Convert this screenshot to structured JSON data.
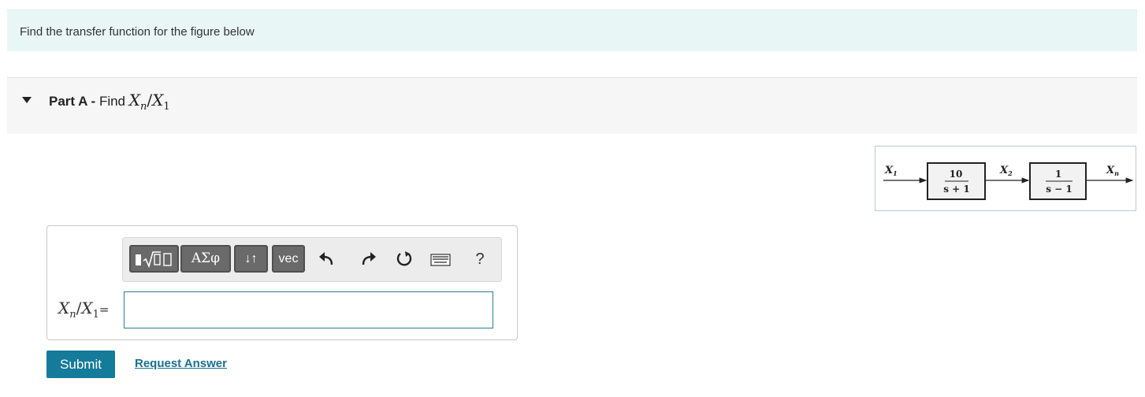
{
  "problem": {
    "text": "Find the transfer function for the figure below"
  },
  "part": {
    "label": "Part A -",
    "find_text": "Find",
    "target": {
      "num_var": "X",
      "num_sub": "n",
      "slash": "/",
      "den_var": "X",
      "den_sub": "1"
    }
  },
  "figure": {
    "signals": {
      "input": "X",
      "input_sub": "1",
      "middle": "X",
      "middle_sub": "2",
      "output": "X",
      "output_sub": "n"
    },
    "block1": {
      "numerator": "10",
      "denominator": "s + 1"
    },
    "block2": {
      "numerator": "1",
      "denominator": "s − 1"
    }
  },
  "toolbar": {
    "templates_icon": "templates-icon",
    "greek_label": "ΑΣφ",
    "arrows_label": "↓↑",
    "vec_label": "vec",
    "undo_icon": "undo-icon",
    "redo_icon": "redo-icon",
    "reset_icon": "reset-icon",
    "keyboard_icon": "keyboard-icon",
    "help_label": "?"
  },
  "answer": {
    "label": {
      "num_var": "X",
      "num_sub": "n",
      "slash": "/",
      "den_var": "X",
      "den_sub": "1",
      "equals": "="
    },
    "value": ""
  },
  "actions": {
    "submit_label": "Submit",
    "request_label": "Request Answer"
  },
  "colors": {
    "accent": "#157b9a",
    "problem_bg": "#e9f6f6",
    "part_bg": "#f6f6f6"
  }
}
